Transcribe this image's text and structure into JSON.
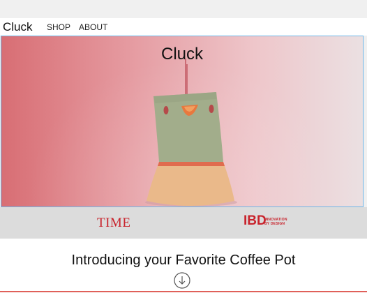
{
  "nav": {
    "brand": "Cluck",
    "links": [
      "SHOP",
      "ABOUT"
    ]
  },
  "hero": {
    "title": "Cluck",
    "image": "coffee-pot-bird-illustration"
  },
  "press": {
    "logos": [
      {
        "name": "time-logo",
        "text": "TIME",
        "color": "#c8232c"
      },
      {
        "name": "ibd-logo",
        "mark": "IBD",
        "lines": [
          "INNOVATION",
          "BY DESIGN"
        ],
        "color": "#c8232c"
      }
    ]
  },
  "intro": {
    "title": "Introducing your Favorite Coffee Pot",
    "scroll_icon": "arrow-down-circle-icon"
  },
  "colors": {
    "accent_red": "#c8232c",
    "hero_left": "#d86e74",
    "hero_right": "#ebe0e2",
    "selection_border": "#6fb6e8"
  }
}
